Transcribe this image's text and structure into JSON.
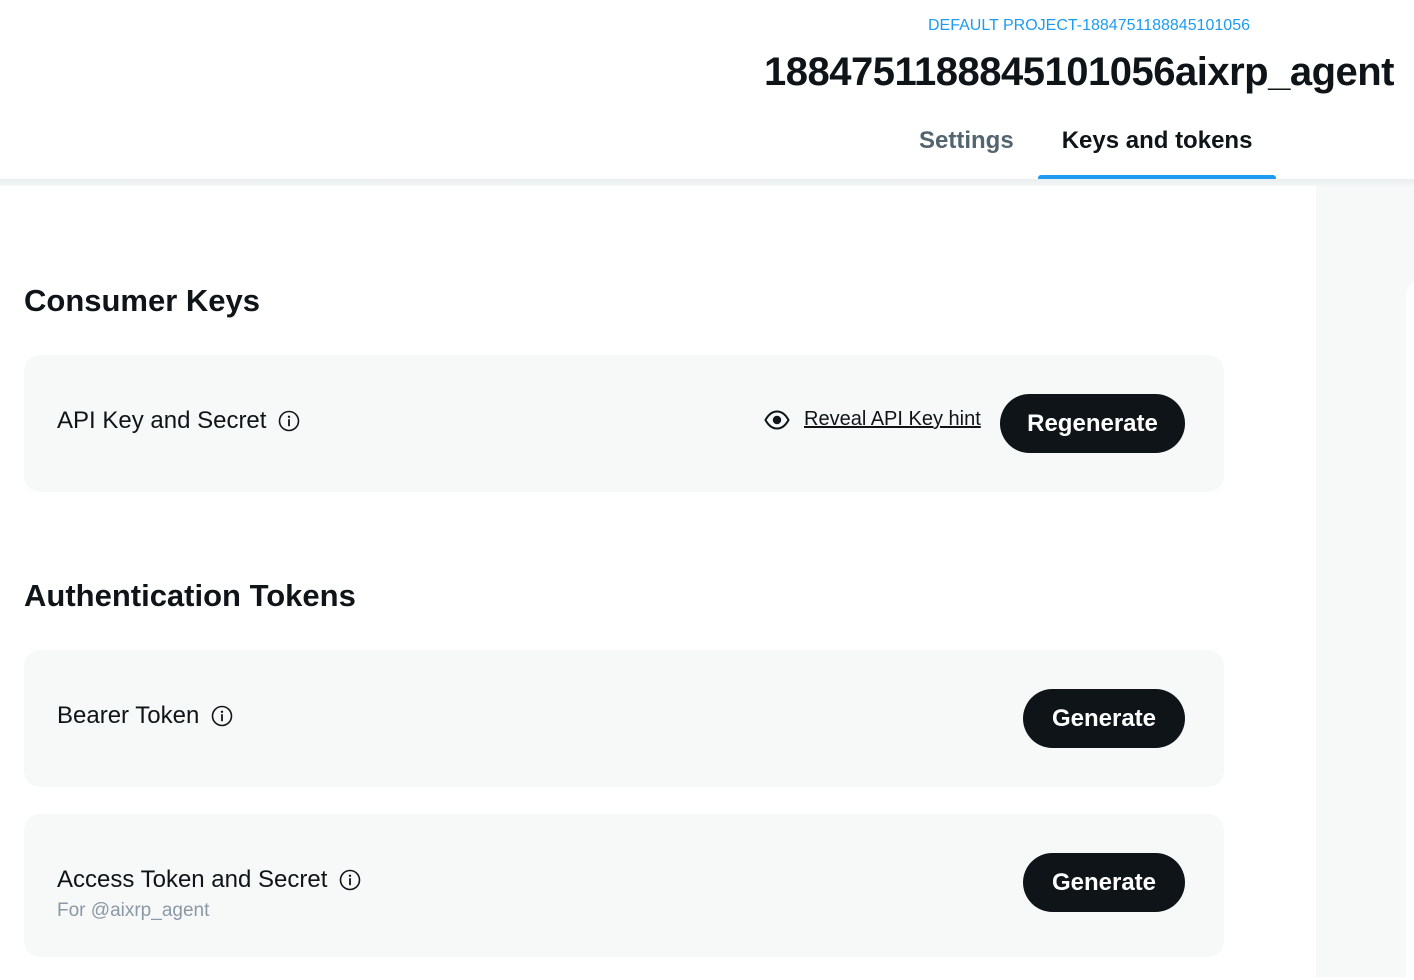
{
  "header": {
    "project_label": "DEFAULT PROJECT-1884751188845101056",
    "app_title": "1884751188845101056aixrp_agent",
    "tabs": [
      {
        "label": "Settings",
        "active": false
      },
      {
        "label": "Keys and tokens",
        "active": true
      }
    ]
  },
  "consumer_keys": {
    "title": "Consumer Keys",
    "api_key": {
      "label": "API Key and Secret",
      "info_icon": "info-icon",
      "reveal_icon": "eye-icon",
      "reveal_label": "Reveal API Key hint",
      "button_label": "Regenerate"
    }
  },
  "auth_tokens": {
    "title": "Authentication Tokens",
    "bearer": {
      "label": "Bearer Token",
      "info_icon": "info-icon",
      "button_label": "Generate"
    },
    "access": {
      "label": "Access Token and Secret",
      "sublabel": "For @aixrp_agent",
      "info_icon": "info-icon",
      "button_label": "Generate"
    }
  },
  "colors": {
    "accent": "#1d9bf0",
    "text_primary": "#0f1419",
    "text_secondary": "#536471",
    "card_bg": "#f7f9f9",
    "button_bg": "#0f1419"
  }
}
